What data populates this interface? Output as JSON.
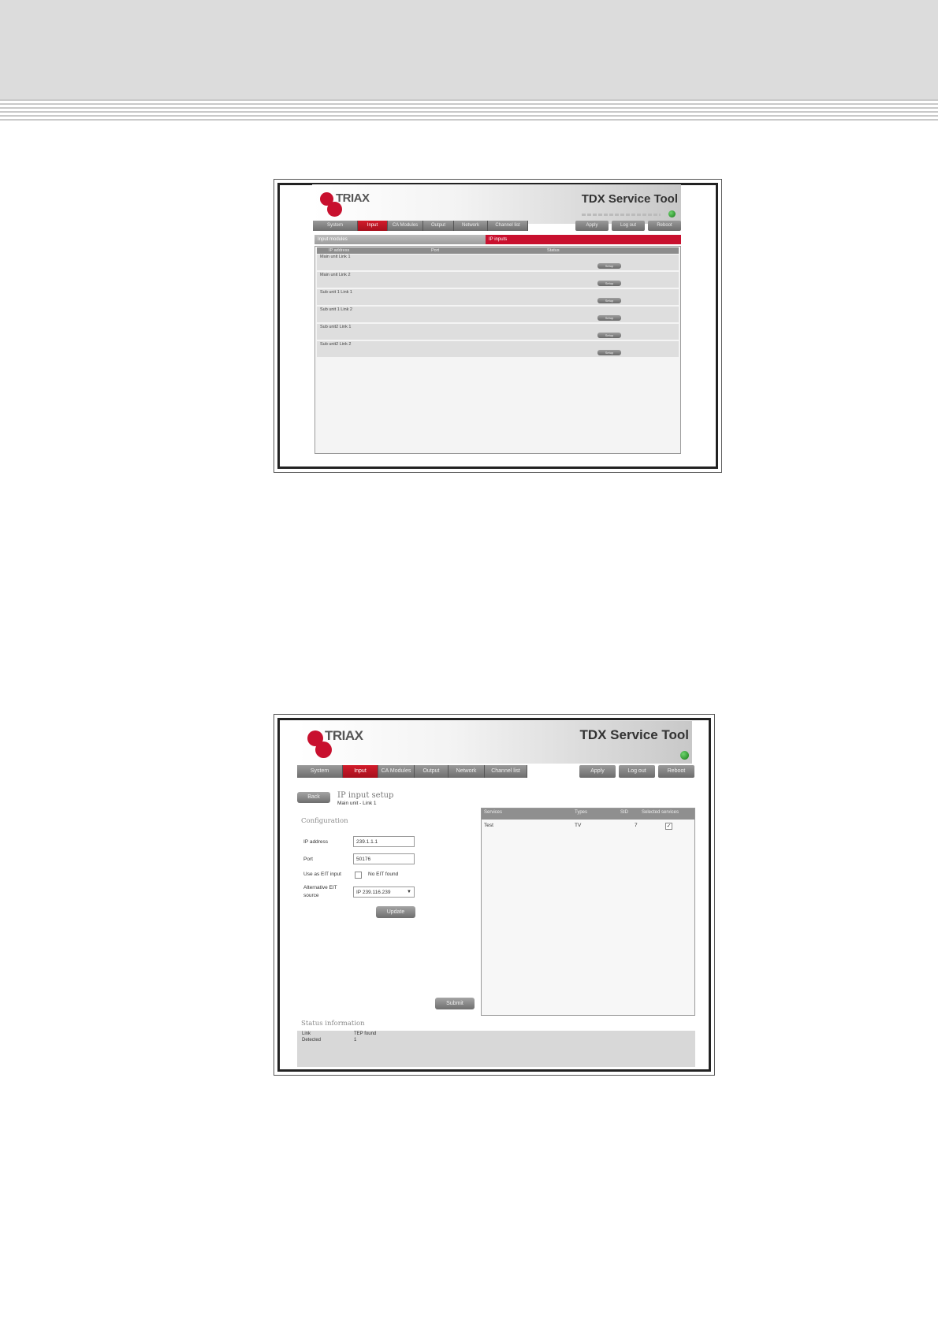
{
  "screenshot1": {
    "app_title": "TDX Service Tool",
    "logo_text": "TRIAX",
    "tabs": [
      "System",
      "Input",
      "CA Modules",
      "Output",
      "Network",
      "Channel list"
    ],
    "active_tab": "Input",
    "actions": [
      "Apply",
      "Log out",
      "Reboot"
    ],
    "subtabs": {
      "left": "Input modules",
      "right": "IP inputs"
    },
    "columns": [
      "IP address",
      "Port",
      "Status"
    ],
    "rows": [
      {
        "label": "Main unit Link 1",
        "button": "Setup"
      },
      {
        "label": "Main unit Link 2",
        "button": "Setup"
      },
      {
        "label": "Sub unit 1 Link 1",
        "button": "Setup"
      },
      {
        "label": "Sub unit 1 Link 2",
        "button": "Setup"
      },
      {
        "label": "Sub unit2 Link 1",
        "button": "Setup"
      },
      {
        "label": "Sub unit2 Link 2",
        "button": "Setup"
      }
    ]
  },
  "screenshot2": {
    "app_title": "TDX Service Tool",
    "logo_text": "TRIAX",
    "tabs": [
      "System",
      "Input",
      "CA Modules",
      "Output",
      "Network",
      "Channel list"
    ],
    "active_tab": "Input",
    "actions": [
      "Apply",
      "Log out",
      "Reboot"
    ],
    "back_button": "Back",
    "page_title": "IP input setup",
    "page_subtitle": "Main unit - Link 1",
    "config_heading": "Configuration",
    "fields": {
      "ip_label": "IP address",
      "ip_value": "239.1.1.1",
      "port_label": "Port",
      "port_value": "50176",
      "eit_label": "Use as EIT input",
      "eit_status": "No EIT found",
      "alt_eit_label_1": "Alternative EIT",
      "alt_eit_label_2": "source",
      "alt_eit_value": "IP 239.116.239"
    },
    "update_button": "Update",
    "submit_button": "Submit",
    "services_table": {
      "columns": [
        "Services",
        "Types",
        "SID",
        "Selected services"
      ],
      "rows": [
        {
          "service": "Test",
          "type": "TV",
          "sid": "7",
          "selected": "✓"
        }
      ]
    },
    "status_heading": "Status information",
    "status": [
      {
        "key": "Link",
        "value": "TEP found"
      },
      {
        "key": "Detected",
        "value": "1"
      }
    ]
  }
}
